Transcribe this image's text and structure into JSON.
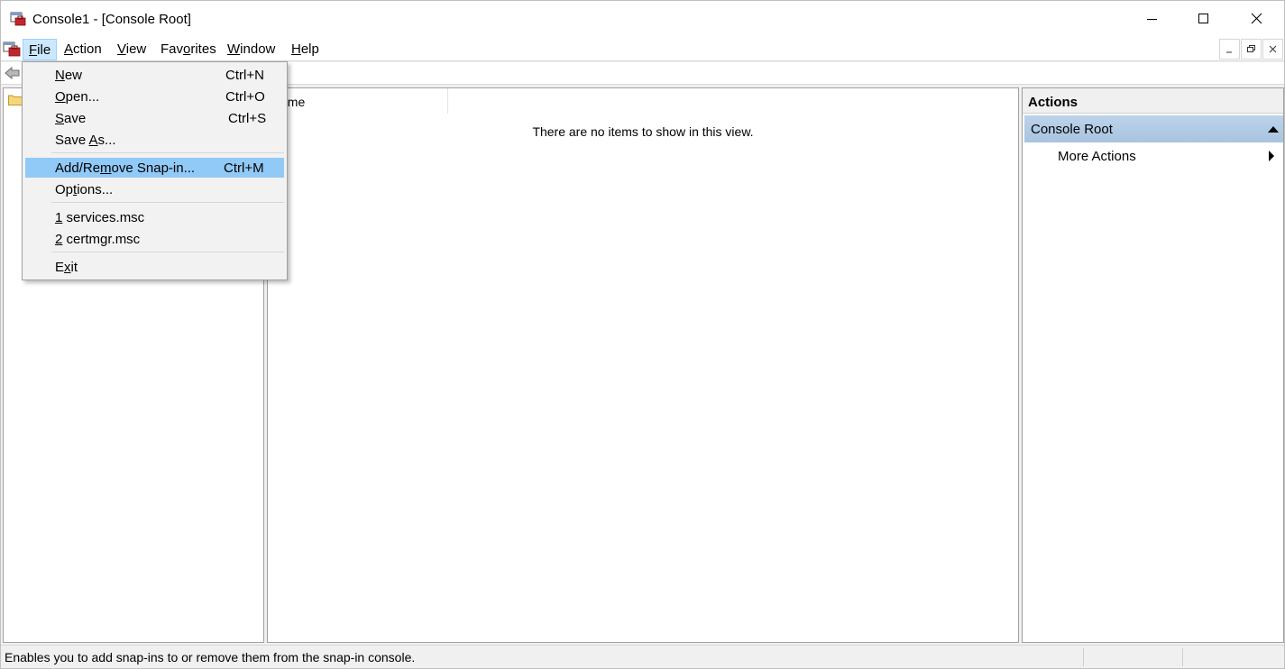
{
  "window": {
    "title": "Console1 - [Console Root]"
  },
  "menubar": {
    "items": [
      {
        "pre": "",
        "key": "F",
        "post": "ile"
      },
      {
        "pre": "",
        "key": "A",
        "post": "ction"
      },
      {
        "pre": "",
        "key": "V",
        "post": "iew"
      },
      {
        "pre": "Fav",
        "key": "o",
        "post": "rites"
      },
      {
        "pre": "",
        "key": "W",
        "post": "indow"
      },
      {
        "pre": "",
        "key": "H",
        "post": "elp"
      }
    ],
    "active": "File"
  },
  "file_menu": {
    "items": [
      {
        "pre": "",
        "key": "N",
        "post": "ew",
        "shortcut": "Ctrl+N"
      },
      {
        "pre": "",
        "key": "O",
        "post": "pen...",
        "shortcut": "Ctrl+O"
      },
      {
        "pre": "",
        "key": "S",
        "post": "ave",
        "shortcut": "Ctrl+S"
      },
      {
        "pre": "Save ",
        "key": "A",
        "post": "s...",
        "shortcut": ""
      },
      {
        "pre": "Add/Re",
        "key": "m",
        "post": "ove Snap-in...",
        "shortcut": "Ctrl+M"
      },
      {
        "pre": "Op",
        "key": "t",
        "post": "ions...",
        "shortcut": ""
      },
      {
        "pre": "",
        "key": "1",
        "post": " services.msc",
        "shortcut": ""
      },
      {
        "pre": "",
        "key": "2",
        "post": " certmgr.msc",
        "shortcut": ""
      },
      {
        "pre": "E",
        "key": "x",
        "post": "it",
        "shortcut": ""
      }
    ],
    "highlighted": "Add/Remove Snap-in..."
  },
  "center": {
    "column_header": "ame",
    "empty_message": "There are no items to show in this view."
  },
  "actions": {
    "header": "Actions",
    "section": "Console Root",
    "link": "More Actions"
  },
  "status": {
    "text": "Enables you to add snap-ins to or remove them from the snap-in console."
  },
  "colors": {
    "menu_highlight": "#91c9f7",
    "menubar_active": "#cce8ff",
    "actions_section": "#b6cee8"
  }
}
